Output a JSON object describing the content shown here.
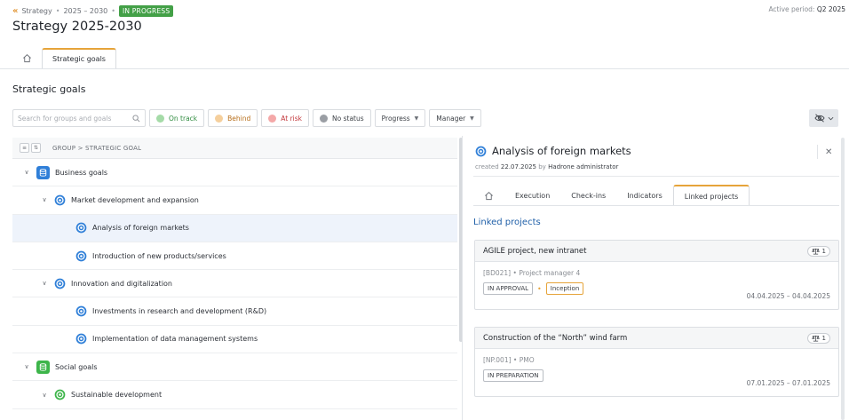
{
  "breadcrumb": {
    "back_icon": "double-chevron-left-icon",
    "items": [
      "Strategy",
      "2025 – 2030"
    ],
    "separator": "•",
    "status_badge": "IN PROGRESS"
  },
  "active_period": {
    "label": "Active period:",
    "value": "Q2 2025"
  },
  "page_title": "Strategy 2025-2030",
  "top_tabs": {
    "home_icon": "home-icon",
    "items": [
      "Strategic goals"
    ]
  },
  "section_title": "Strategic goals",
  "filters": {
    "search_placeholder": "Search for groups and goals",
    "status_chips": [
      {
        "label": "On track",
        "text_color": "#2e8b3e",
        "dot_color": "#a5dba8"
      },
      {
        "label": "Behind",
        "text_color": "#b76e1a",
        "dot_color": "#f5cf9c"
      },
      {
        "label": "At risk",
        "text_color": "#c2363a",
        "dot_color": "#f4a8a8"
      },
      {
        "label": "No status",
        "text_color": "#3a3e44",
        "dot_color": "#9a9ea4"
      }
    ],
    "dropdowns": [
      "Progress",
      "Manager"
    ],
    "visibility_icon": "eye-off-icon"
  },
  "tree": {
    "header_label": "GROUP  >  STRATEGIC GOAL",
    "rows": [
      {
        "level": 0,
        "label": "Business goals",
        "expanded": true,
        "icon_color": "#2f7fd8"
      },
      {
        "level": 1,
        "label": "Market development and expansion",
        "expanded": true,
        "icon_color": "#2f7fd8"
      },
      {
        "level": 2,
        "label": "Analysis of foreign markets",
        "selected": true,
        "icon_color": "#2f7fd8"
      },
      {
        "level": 2,
        "label": "Introduction of new products/services",
        "icon_color": "#2f7fd8"
      },
      {
        "level": 1,
        "label": "Innovation and digitalization",
        "expanded": true,
        "icon_color": "#2f7fd8"
      },
      {
        "level": 2,
        "label": "Investments in research and development (R&D)",
        "icon_color": "#2f7fd8"
      },
      {
        "level": 2,
        "label": "Implementation of data management systems",
        "icon_color": "#2f7fd8"
      },
      {
        "level": 0,
        "label": "Social goals",
        "expanded": true,
        "icon_color": "#3db54a"
      },
      {
        "level": 1,
        "label": "Sustainable development",
        "expanded": true,
        "icon_color": "#3db54a"
      }
    ]
  },
  "panel": {
    "title": "Analysis of foreign markets",
    "created_prefix": "created",
    "created_date": "22.07.2025",
    "created_by_prefix": "by",
    "created_by": "Hadrone administrator",
    "close_icon": "close-icon",
    "tabs": [
      "Execution",
      "Check-ins",
      "Indicators",
      "Linked projects"
    ],
    "active_tab": "Linked projects",
    "linked_projects_title": "Linked projects",
    "projects": [
      {
        "name": "AGILE project, new intranet",
        "count": "1",
        "code": "[BD021]",
        "manager": "Project manager 4",
        "status": "IN APPROVAL",
        "phase": "Inception",
        "dates": "04.04.2025 – 04.04.2025"
      },
      {
        "name": "Construction of the “North” wind farm",
        "count": "1",
        "code": "[NP.001]",
        "manager": "PMO",
        "status": "IN PREPARATION",
        "phase": "",
        "dates": "07.01.2025 – 07.01.2025"
      }
    ]
  },
  "colors": {
    "accent": "#e6a43a",
    "link_blue": "#1f5fa8",
    "status_green": "#43a047"
  }
}
